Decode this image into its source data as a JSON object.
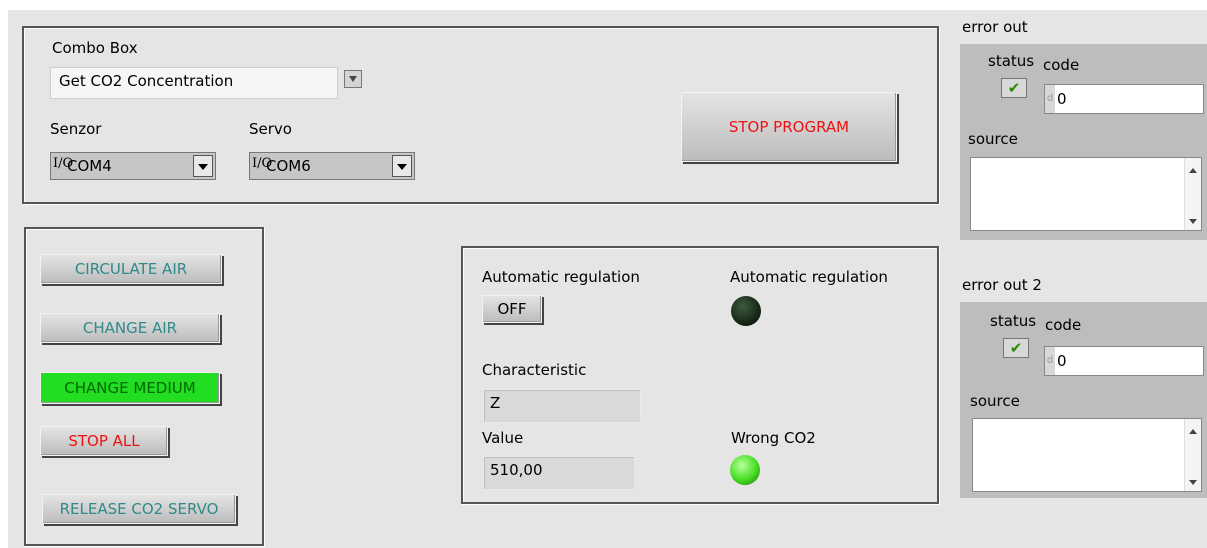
{
  "main_panel": {
    "combo_box_label": "Combo Box",
    "combo_box_value": "Get CO2 Concentration",
    "senzor_label": "Senzor",
    "senzor_value": "COM4",
    "servo_label": "Servo",
    "servo_value": "COM6",
    "visa_icon": "I/O",
    "stop_program_label": "STOP PROGRAM"
  },
  "controls": {
    "circulate_air": "CIRCULATE AIR",
    "change_air": "CHANGE AIR",
    "change_medium": "CHANGE MEDIUM",
    "stop_all": "STOP ALL",
    "release_co2_servo": "RELEASE CO2 SERVO"
  },
  "regulation": {
    "auto_reg_label": "Automatic regulation",
    "auto_reg_toggle": "OFF",
    "auto_reg_indicator_label": "Automatic regulation",
    "characteristic_label": "Characteristic",
    "characteristic_value": "Z",
    "value_label": "Value",
    "value_value": "510,00",
    "wrong_co2_label": "Wrong CO2"
  },
  "error_out": {
    "title": "error out",
    "status_label": "status",
    "code_label": "code",
    "code_value": "0",
    "source_label": "source",
    "status_glyph": "✔",
    "numeric_prefix": "d"
  },
  "error_out_2": {
    "title": "error out 2",
    "status_label": "status",
    "code_label": "code",
    "code_value": "0",
    "source_label": "source",
    "status_glyph": "✔",
    "numeric_prefix": "d"
  },
  "colors": {
    "panel": "#e5e5e5",
    "led_off": "#1f3a1f",
    "led_on": "#44dd22",
    "medium_bg": "#22dd22",
    "teal_text": "#2f8a8a",
    "red_text": "#ee1111"
  }
}
